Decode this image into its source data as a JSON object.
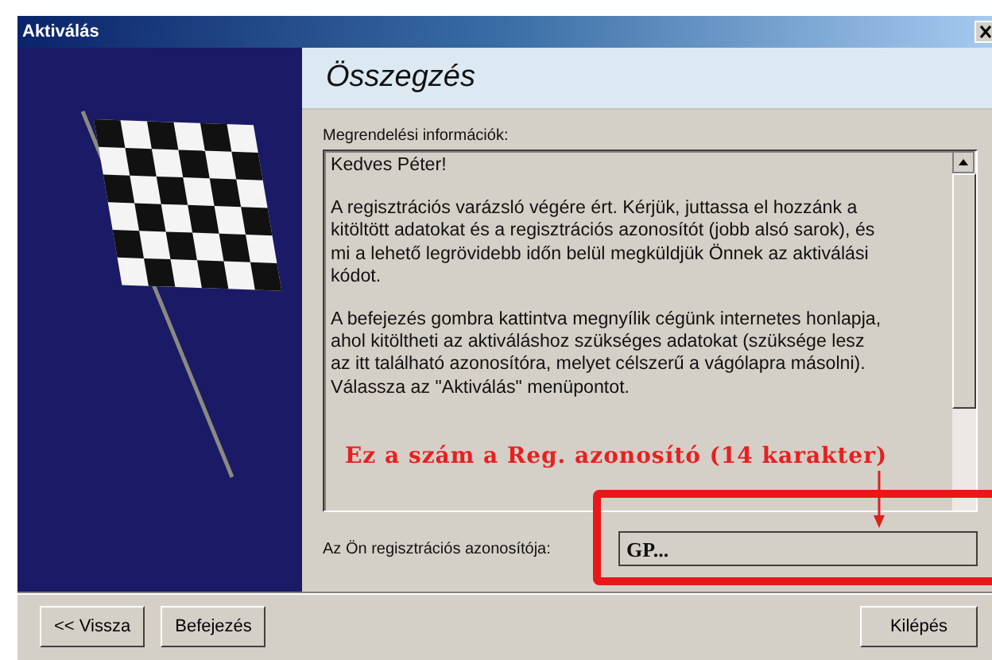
{
  "window": {
    "title": "Aktiválás"
  },
  "header": {
    "title": "Összegzés"
  },
  "order_info": {
    "label": "Megrendelési információk:",
    "paragraphs": [
      [
        "Kedves Péter!"
      ],
      [
        "A regisztrációs varázsló végére ért. Kérjük, juttassa el hozzánk a",
        "kitöltött adatokat és a regisztrációs azonosítót (jobb alsó sarok), és",
        "mi a lehető legrövidebb időn belül megküldjük Önnek az aktiválási",
        "kódot."
      ],
      [
        "A befejezés gombra kattintva megnyílik cégünk internetes honlapja,",
        "ahol kitöltheti az aktiváláshoz szükséges adatokat (szüksége lesz",
        "az itt található azonosítóra, melyet célszerű a vágólapra másolni).",
        "Válassza az \"Aktiválás\" menüpontot."
      ]
    ]
  },
  "annotation": {
    "text": "Ez a szám a Reg. azonosító (14 karakter)"
  },
  "registration_id": {
    "label": "Az Ön regisztrációs azonosítója:",
    "value": "GP..."
  },
  "nav_buttons": [
    "<< Vissza",
    "Befejezés"
  ],
  "exit_button": "Kilépés"
}
